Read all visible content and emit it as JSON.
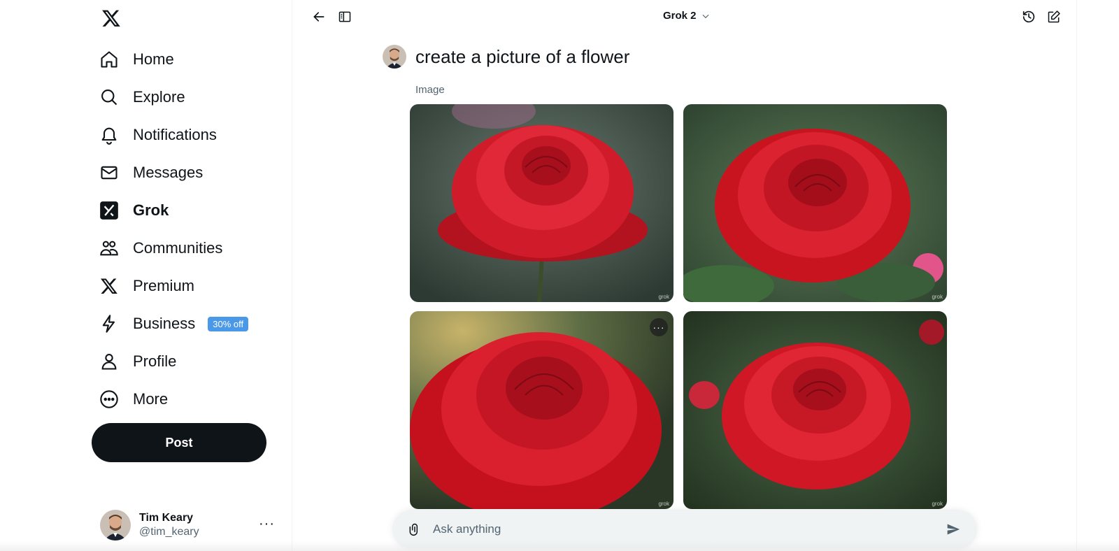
{
  "app": {
    "logo_icon": "x-logo-icon"
  },
  "sidebar": {
    "items": [
      {
        "label": "Home",
        "icon": "home-icon"
      },
      {
        "label": "Explore",
        "icon": "search-icon"
      },
      {
        "label": "Notifications",
        "icon": "bell-icon"
      },
      {
        "label": "Messages",
        "icon": "mail-icon"
      },
      {
        "label": "Grok",
        "icon": "grok-icon",
        "active": true
      },
      {
        "label": "Communities",
        "icon": "communities-icon"
      },
      {
        "label": "Premium",
        "icon": "x-logo-icon"
      },
      {
        "label": "Business",
        "icon": "lightning-icon",
        "badge": "30% off"
      },
      {
        "label": "Profile",
        "icon": "person-icon"
      },
      {
        "label": "More",
        "icon": "more-circle-icon"
      }
    ],
    "post_label": "Post",
    "account": {
      "name": "Tim Keary",
      "handle": "@tim_keary"
    }
  },
  "header": {
    "model": "Grok 2"
  },
  "conversation": {
    "prompt": "create a picture of a flower",
    "response_label": "Image",
    "images": [
      {
        "alt": "red rose",
        "watermark": "grok"
      },
      {
        "alt": "red rose",
        "watermark": "grok"
      },
      {
        "alt": "red rose",
        "watermark": "grok"
      },
      {
        "alt": "red rose",
        "watermark": "grok"
      }
    ]
  },
  "composer": {
    "placeholder": "Ask anything"
  },
  "colors": {
    "accent": "#0f1419",
    "badge": "#4a99e9",
    "rose": "#d61f2c"
  }
}
